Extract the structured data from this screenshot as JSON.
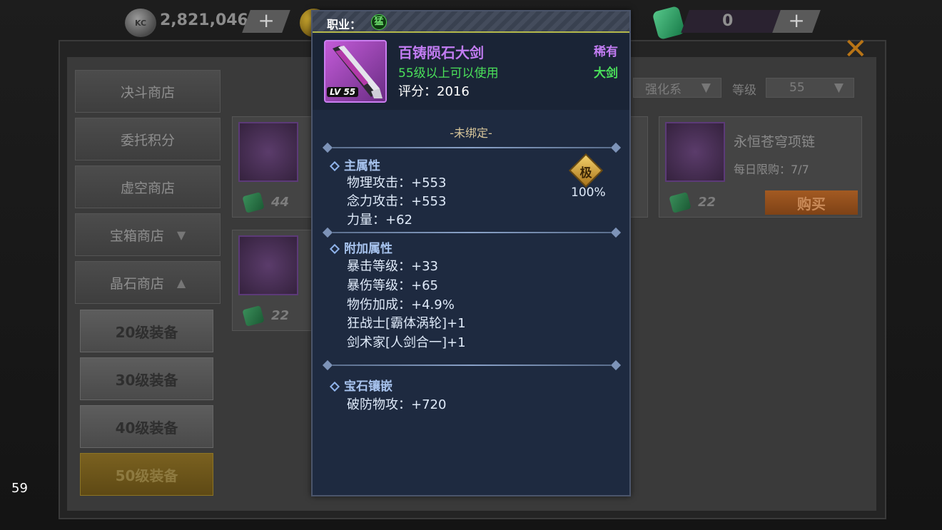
{
  "topbar": {
    "coin_value": "2,821,046",
    "coin_icon_text": "KC",
    "gem_value": "0",
    "plus_label": "+"
  },
  "sidebar": {
    "items": [
      {
        "label": "决斗商店"
      },
      {
        "label": "委托积分"
      },
      {
        "label": "虚空商店"
      },
      {
        "label": "宝箱商店",
        "chevron": "chevron-down"
      },
      {
        "label": "晶石商店",
        "chevron": "chevron-up"
      }
    ],
    "sub_items": [
      {
        "label": "20级装备"
      },
      {
        "label": "30级装备"
      },
      {
        "label": "40级装备"
      },
      {
        "label": "50级装备",
        "active": true
      }
    ]
  },
  "filters": {
    "type_value": "强化系",
    "level_label": "等级",
    "level_value": "55",
    "chevron": "▼"
  },
  "shop_items": [
    {
      "price": "44"
    },
    {
      "price": "22"
    },
    {
      "name": "永恒苍穹项链",
      "limit": "每日限购：7/7",
      "price": "22",
      "buy_label": "购买"
    },
    {
      "price": "22"
    }
  ],
  "fps": "59",
  "tooltip": {
    "header_label": "职业：",
    "class_icon": "猛",
    "item": {
      "name": "百铸陨石大剑",
      "requirement": "55级以上可以使用",
      "score": "评分：2016",
      "rarity": "稀有",
      "weapon_type": "大剑",
      "level_badge": "LV 55"
    },
    "bind_status": "-未绑定-",
    "main_attributes": {
      "title": "主属性",
      "lines": [
        "物理攻击：+553",
        "念力攻击：+553",
        "力量：+62"
      ],
      "grade": "极",
      "grade_percent": "100%"
    },
    "bonus_attributes": {
      "title": "附加属性",
      "lines": [
        "暴击等级：+33",
        "暴伤等级：+65",
        "物伤加成：+4.9%",
        "狂战士[霸体涡轮]+1",
        "剑术家[人剑合一]+1"
      ]
    },
    "gem_slots": {
      "title": "宝石镶嵌",
      "lines": [
        "破防物攻：+720"
      ]
    }
  },
  "colors": {
    "rare_purple": "#c27cf2",
    "usable_green": "#4ae05a",
    "section_blue": "#a8c4ef",
    "panel_bg": "#1e2a40"
  }
}
